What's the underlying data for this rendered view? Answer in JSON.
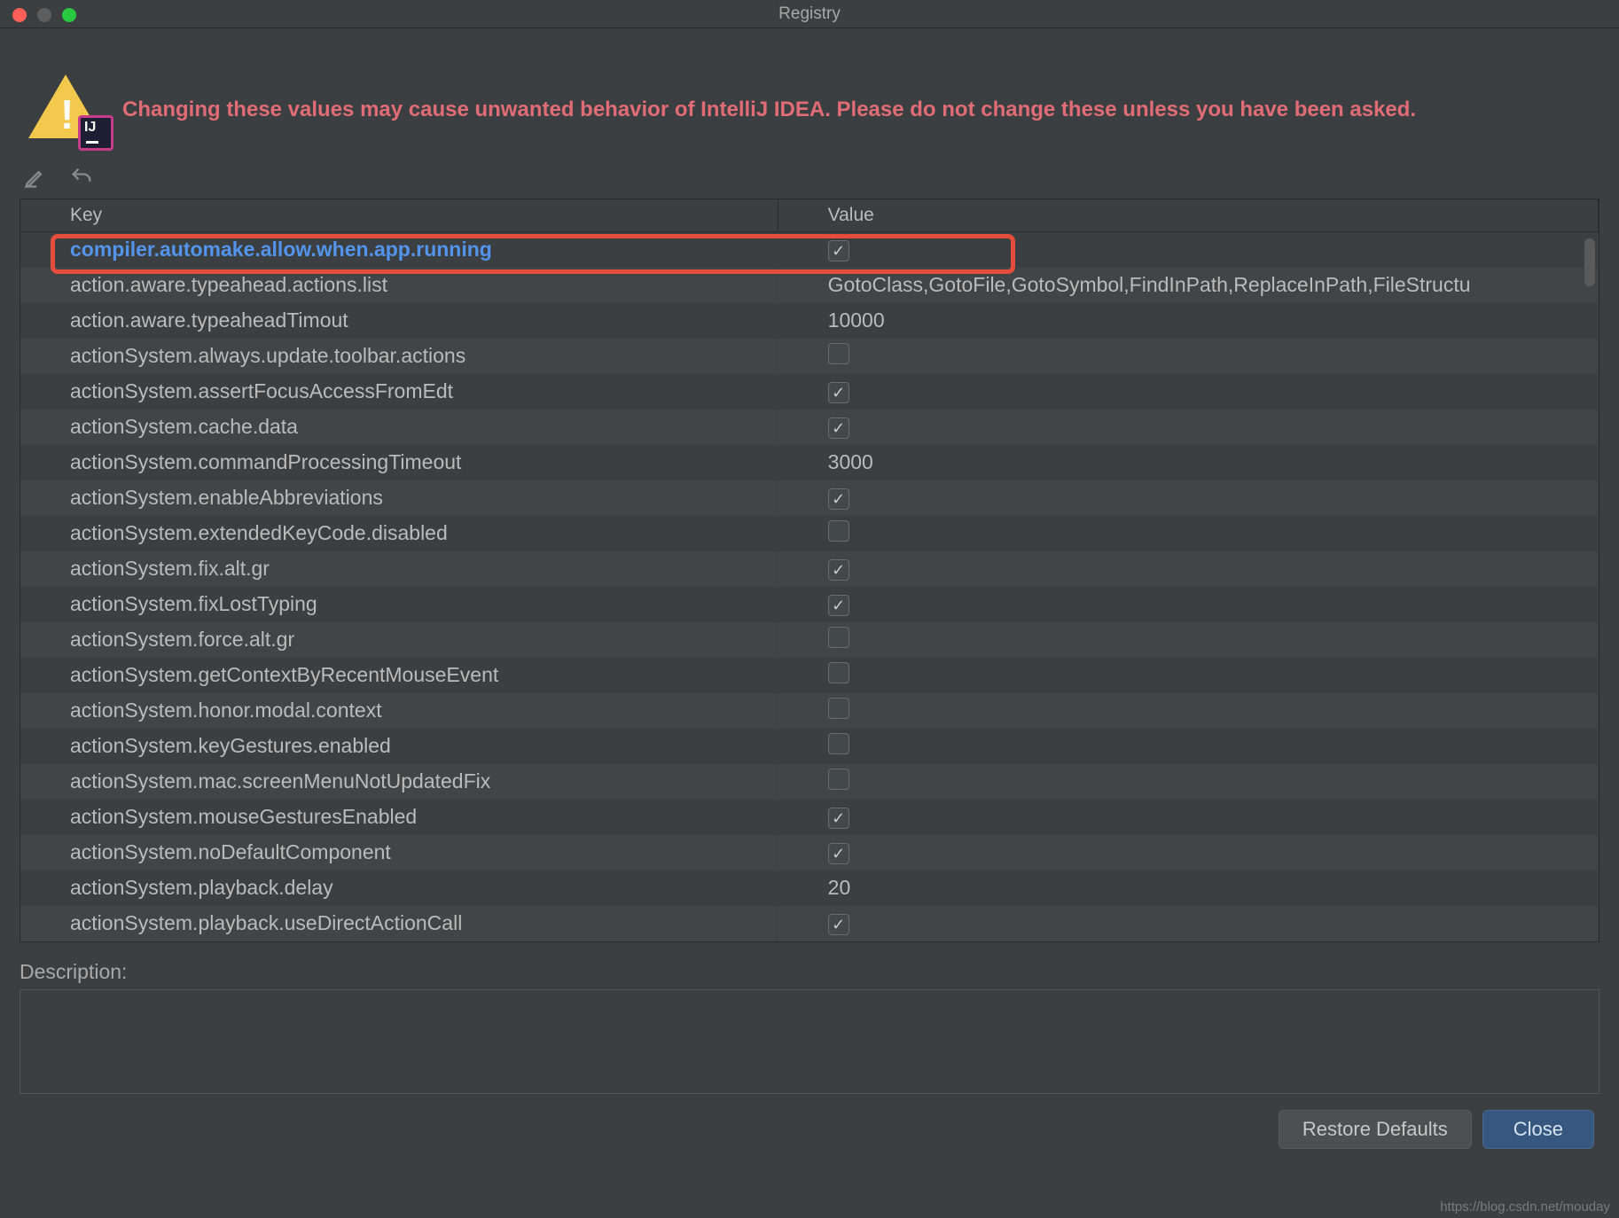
{
  "window": {
    "title": "Registry"
  },
  "warning": {
    "text": "Changing these values may cause unwanted behavior of IntelliJ IDEA. Please do not change these unless you have been asked."
  },
  "table": {
    "headers": {
      "key": "Key",
      "value": "Value"
    },
    "rows": [
      {
        "key": "compiler.automake.allow.when.app.running",
        "type": "check",
        "checked": true,
        "selected": true
      },
      {
        "key": "action.aware.typeahead.actions.list",
        "type": "text",
        "value": "GotoClass,GotoFile,GotoSymbol,FindInPath,ReplaceInPath,FileStructu"
      },
      {
        "key": "action.aware.typeaheadTimout",
        "type": "text",
        "value": "10000"
      },
      {
        "key": "actionSystem.always.update.toolbar.actions",
        "type": "check",
        "checked": false
      },
      {
        "key": "actionSystem.assertFocusAccessFromEdt",
        "type": "check",
        "checked": true
      },
      {
        "key": "actionSystem.cache.data",
        "type": "check",
        "checked": true
      },
      {
        "key": "actionSystem.commandProcessingTimeout",
        "type": "text",
        "value": "3000"
      },
      {
        "key": "actionSystem.enableAbbreviations",
        "type": "check",
        "checked": true
      },
      {
        "key": "actionSystem.extendedKeyCode.disabled",
        "type": "check",
        "checked": false
      },
      {
        "key": "actionSystem.fix.alt.gr",
        "type": "check",
        "checked": true
      },
      {
        "key": "actionSystem.fixLostTyping",
        "type": "check",
        "checked": true
      },
      {
        "key": "actionSystem.force.alt.gr",
        "type": "check",
        "checked": false
      },
      {
        "key": "actionSystem.getContextByRecentMouseEvent",
        "type": "check",
        "checked": false
      },
      {
        "key": "actionSystem.honor.modal.context",
        "type": "check",
        "checked": false
      },
      {
        "key": "actionSystem.keyGestures.enabled",
        "type": "check",
        "checked": false
      },
      {
        "key": "actionSystem.mac.screenMenuNotUpdatedFix",
        "type": "check",
        "checked": false
      },
      {
        "key": "actionSystem.mouseGesturesEnabled",
        "type": "check",
        "checked": true
      },
      {
        "key": "actionSystem.noDefaultComponent",
        "type": "check",
        "checked": true
      },
      {
        "key": "actionSystem.playback.delay",
        "type": "text",
        "value": "20"
      },
      {
        "key": "actionSystem.playback.useDirectActionCall",
        "type": "check",
        "checked": true
      }
    ]
  },
  "description": {
    "label": "Description:"
  },
  "footer": {
    "restore": "Restore Defaults",
    "close": "Close"
  },
  "watermark": "https://blog.csdn.net/mouday"
}
